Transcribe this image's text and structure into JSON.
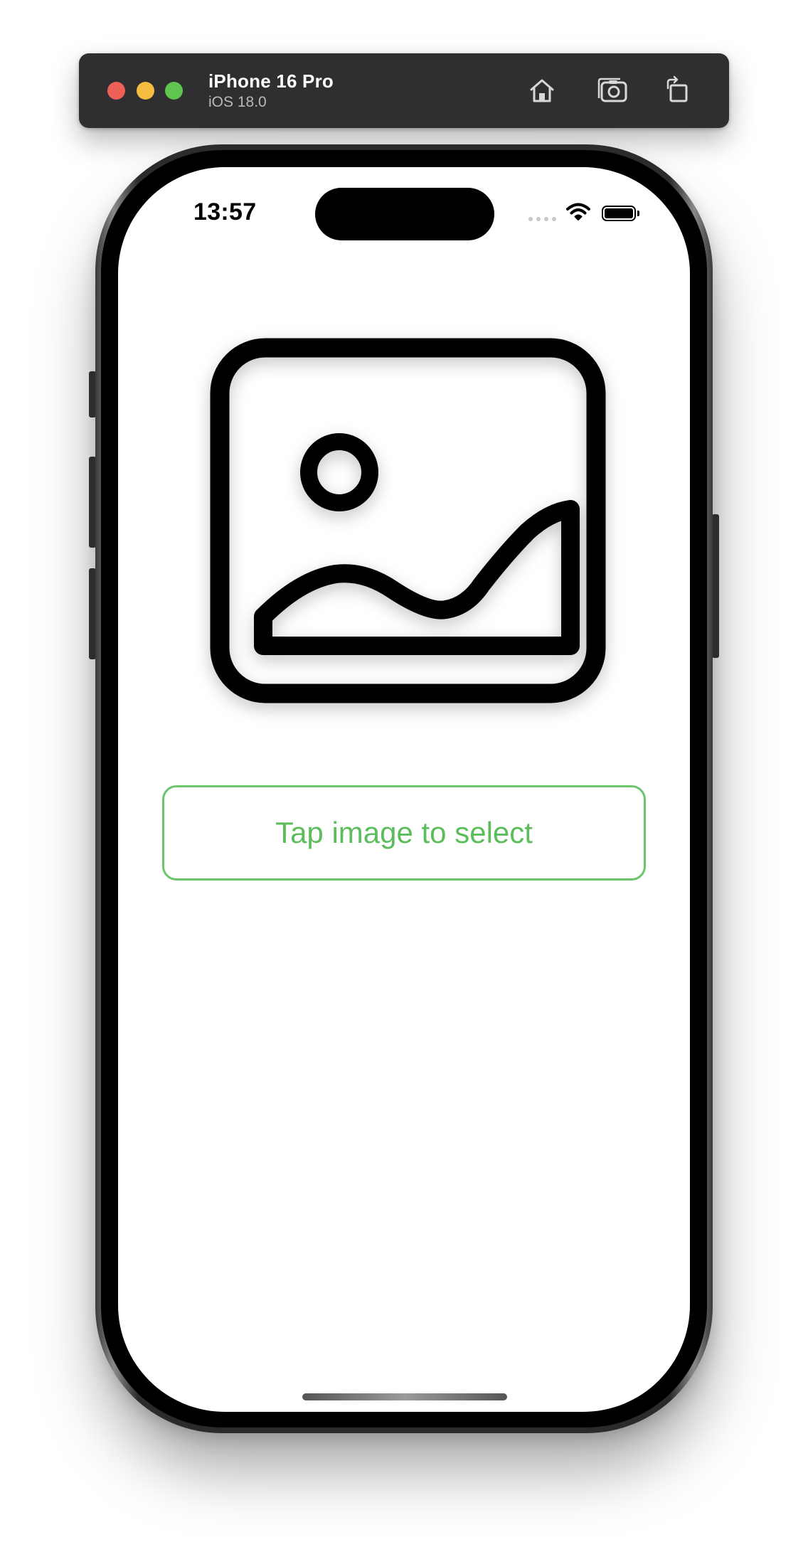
{
  "simulator": {
    "device_name": "iPhone 16 Pro",
    "os_version": "iOS 18.0",
    "toolbar_buttons": [
      {
        "icon": "home-icon"
      },
      {
        "icon": "screenshot-icon"
      },
      {
        "icon": "rotate-icon"
      }
    ],
    "window_controls": [
      "close",
      "minimize",
      "zoom"
    ]
  },
  "status_bar": {
    "time": "13:57",
    "icons": [
      "cellular-signal-icon",
      "wifi-icon",
      "battery-icon"
    ],
    "battery_level": 1.0
  },
  "main": {
    "image_placeholder_icon": "photo-icon",
    "select_button_label": "Tap image to select"
  },
  "colors": {
    "accent_green": "#5dbd5d",
    "toolbar_bg": "#2f2f31",
    "close": "#ee5f57",
    "minimize": "#f5bd3f",
    "zoom": "#5fc54f"
  }
}
